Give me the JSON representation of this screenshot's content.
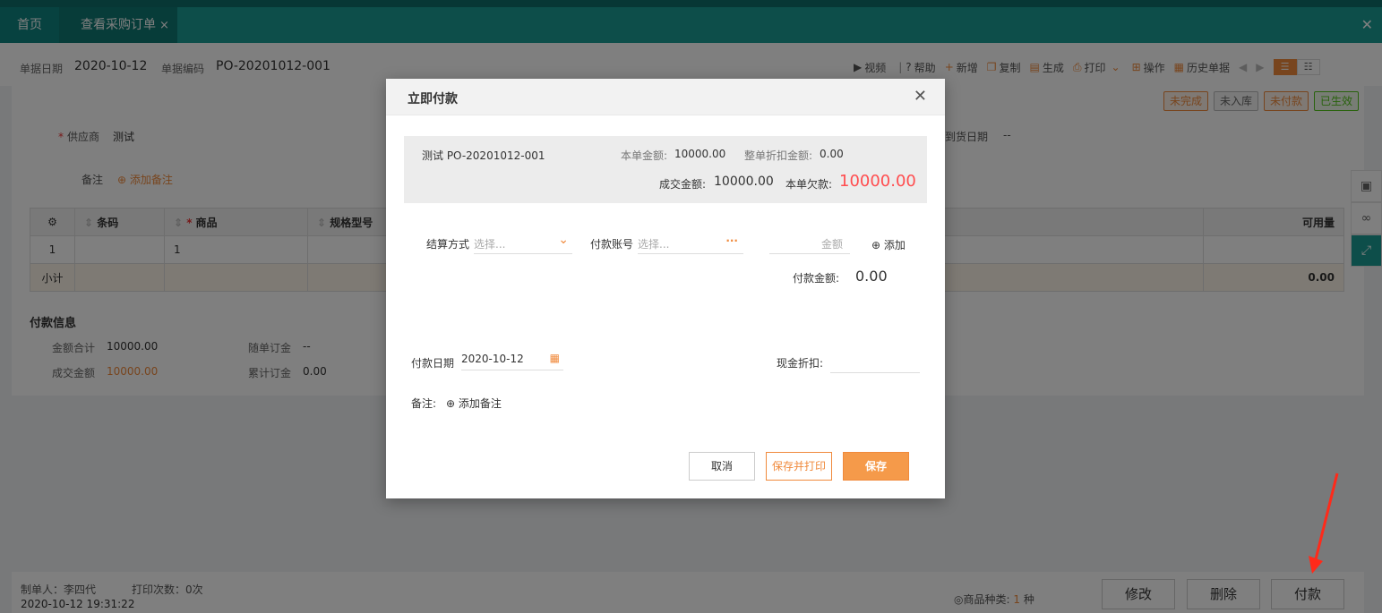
{
  "tabs": {
    "home": "首页",
    "active": "查看采购订单",
    "close": "×"
  },
  "close_all": "✕",
  "header": {
    "date_label": "单据日期",
    "date_value": "2020-10-12",
    "code_label": "单据编码",
    "code_value": "PO-20201012-001"
  },
  "toolbar": {
    "video": "视频",
    "help": "帮助",
    "new": "新增",
    "copy": "复制",
    "generate": "生成",
    "print": "打印",
    "operate": "操作",
    "history": "历史单据"
  },
  "status_badges": [
    "未完成",
    "未入库",
    "未付款",
    "已生效"
  ],
  "form": {
    "supplier_label": "供应商",
    "supplier_value": "测试",
    "delivery_label": "到货日期",
    "delivery_value": "--",
    "remark_label": "备注",
    "add_remark": "添加备注"
  },
  "table": {
    "headers": [
      "条码",
      "商品",
      "规格型号",
      "可用量"
    ],
    "rows": [
      {
        "index": "1",
        "product": "1"
      }
    ],
    "subtotal_label": "小计",
    "subtotal_value": "0.00"
  },
  "payinfo": {
    "title": "付款信息",
    "total_label": "金额合计",
    "total_value": "10000.00",
    "deal_label": "成交金额",
    "deal_value": "10000.00",
    "deposit_label": "随单订金",
    "deposit_value": "--",
    "cumulative_label": "累计订金",
    "cumulative_value": "0.00"
  },
  "footer": {
    "creator": "制单人：李四代",
    "print_count": "打印次数：0次",
    "created_at": "2020-10-12 19:31:22",
    "kinds_label": "商品种类:",
    "kinds_value": "1",
    "kinds_unit": "种",
    "edit": "修改",
    "delete": "删除",
    "pay": "付款"
  },
  "modal": {
    "title": "立即付款",
    "order_ref": "测试 PO-20201012-001",
    "order_amount_label": "本单金额:",
    "order_amount": "10000.00",
    "discount_label": "整单折扣金额:",
    "discount": "0.00",
    "deal_label": "成交金额:",
    "deal": "10000.00",
    "owed_label": "本单欠款:",
    "owed": "10000.00",
    "settle_label": "结算方式",
    "settle_placeholder": "选择...",
    "account_label": "付款账号",
    "account_placeholder": "选择...",
    "amount_placeholder": "金额",
    "add": "添加",
    "pay_amount_label": "付款金额:",
    "pay_amount": "0.00",
    "pay_date_label": "付款日期",
    "pay_date": "2020-10-12",
    "cash_discount_label": "现金折扣:",
    "remark_label": "备注:",
    "add_remark": "添加备注",
    "cancel": "取消",
    "save_print": "保存并打印",
    "save": "保存"
  },
  "colors": {
    "accent": "#f08a3c",
    "teal": "#1a9c95",
    "red": "#ff4d4f"
  }
}
